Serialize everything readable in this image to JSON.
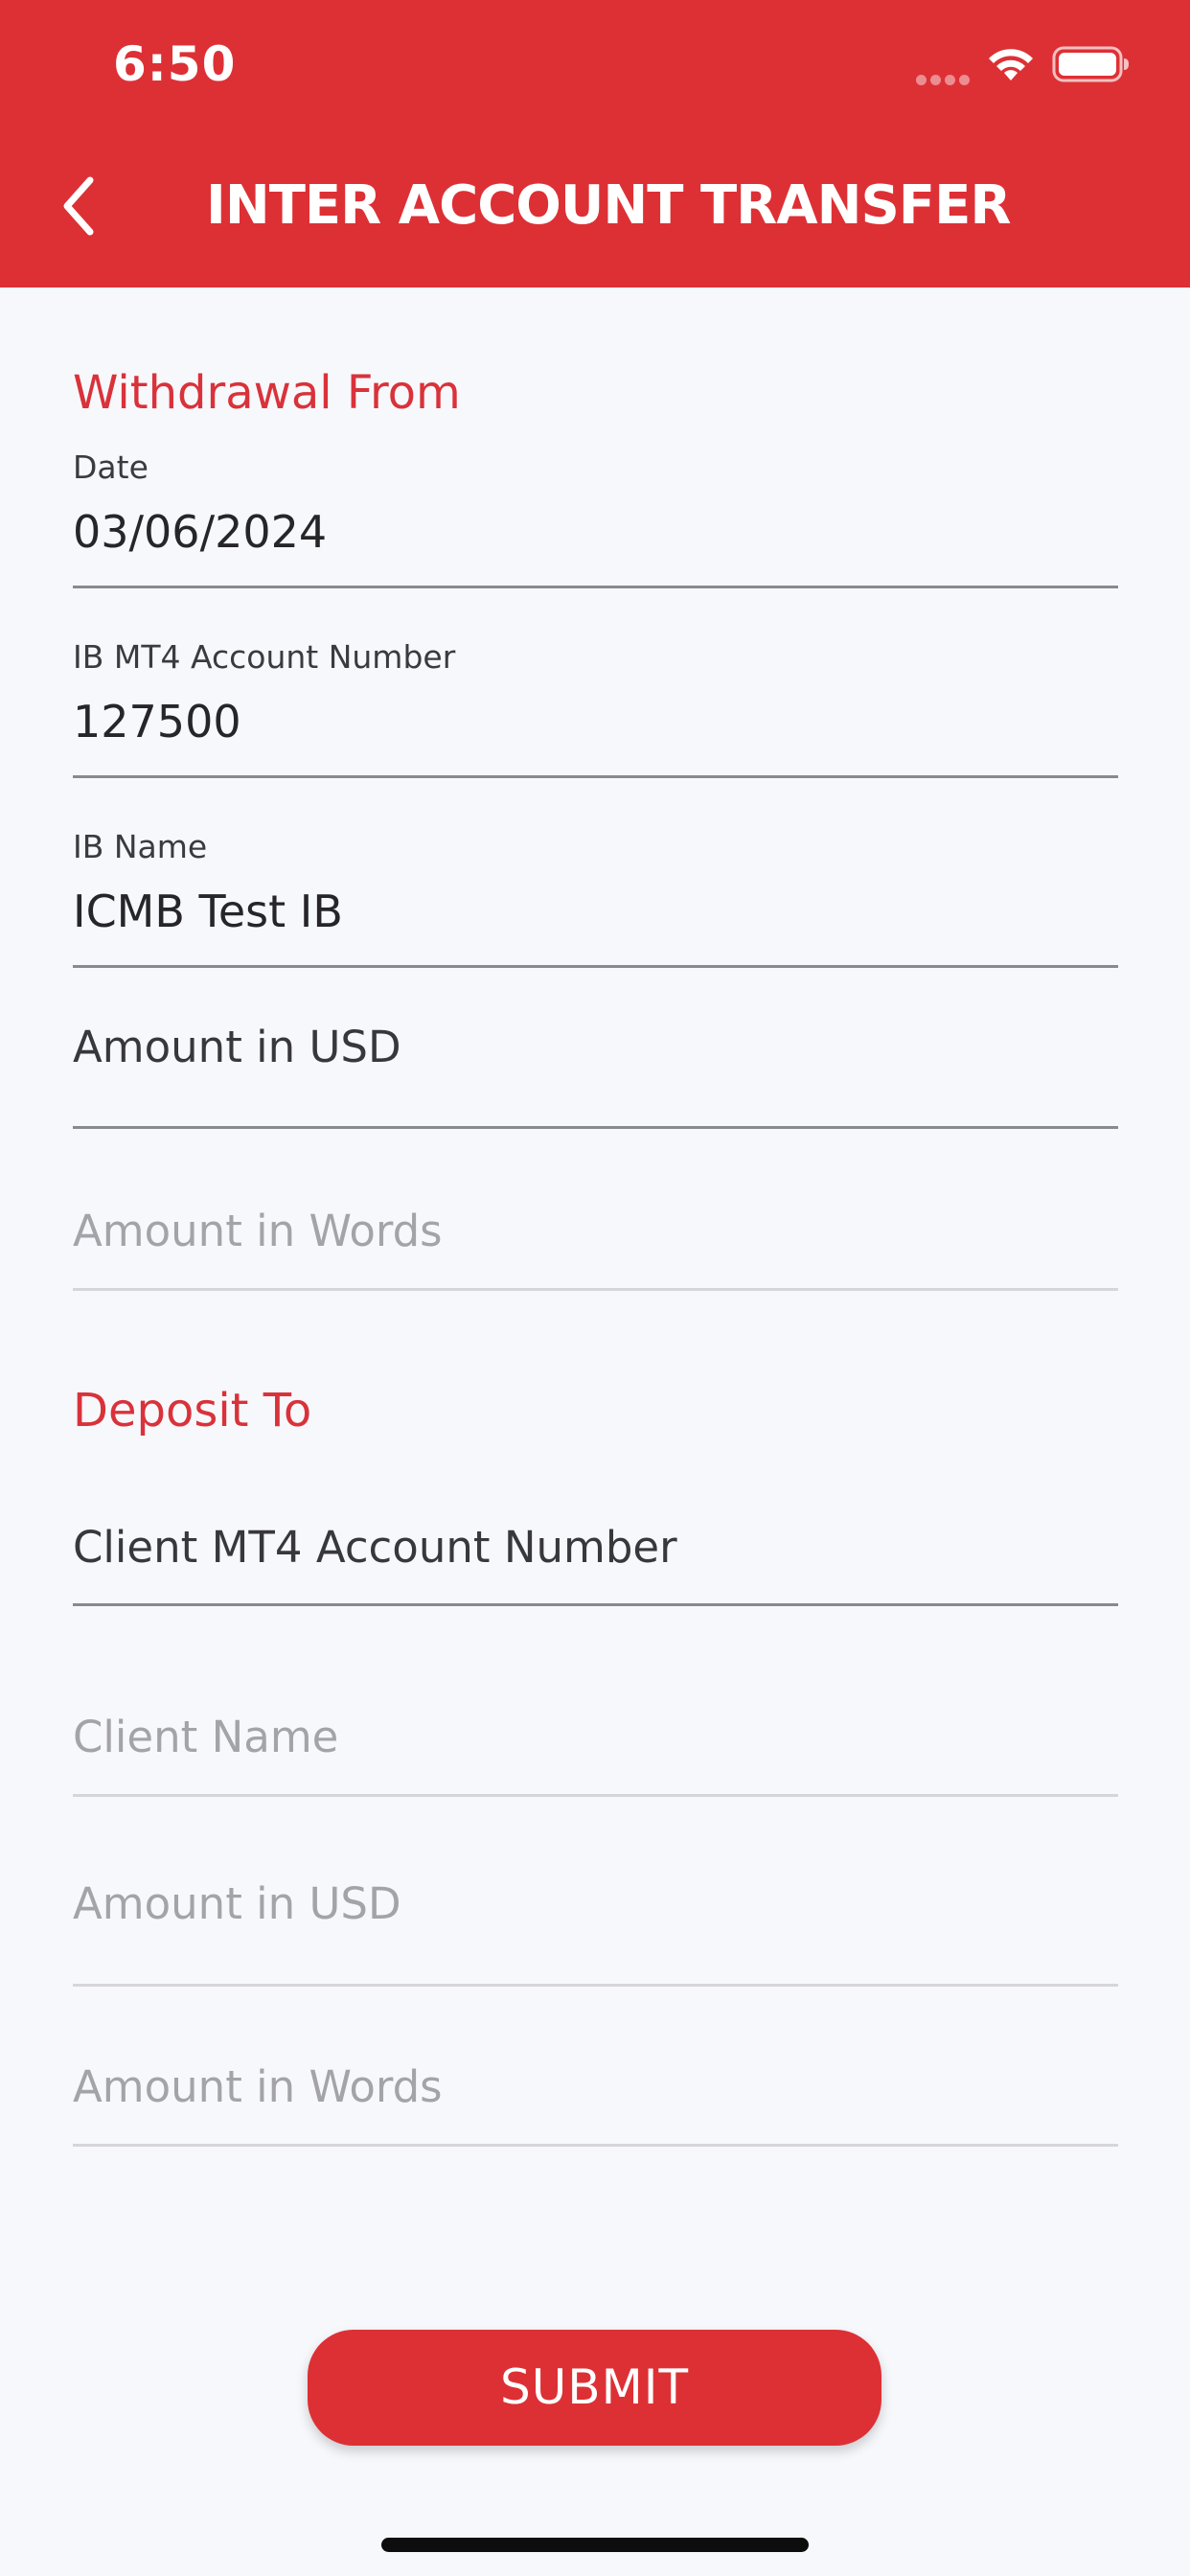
{
  "status_bar": {
    "time": "6:50"
  },
  "header": {
    "title": "INTER ACCOUNT TRANSFER",
    "back_icon": "chevron-left-icon"
  },
  "withdrawal": {
    "section_title": "Withdrawal From",
    "date_label": "Date",
    "date_value": "03/06/2024",
    "account_label": "IB MT4 Account Number",
    "account_value": "127500",
    "name_label": "IB Name",
    "name_value": "ICMB Test IB",
    "amount_usd_label": "Amount in USD",
    "amount_words_placeholder": "Amount in Words"
  },
  "deposit": {
    "section_title": "Deposit To",
    "client_account_label": "Client MT4 Account Number",
    "client_name_placeholder": "Client Name",
    "amount_usd_placeholder": "Amount in USD",
    "amount_words_placeholder": "Amount in Words"
  },
  "actions": {
    "submit_label": "SUBMIT"
  },
  "colors": {
    "brand_red": "#dd3035",
    "section_red": "#d9323a",
    "background": "#f7f8fc"
  }
}
